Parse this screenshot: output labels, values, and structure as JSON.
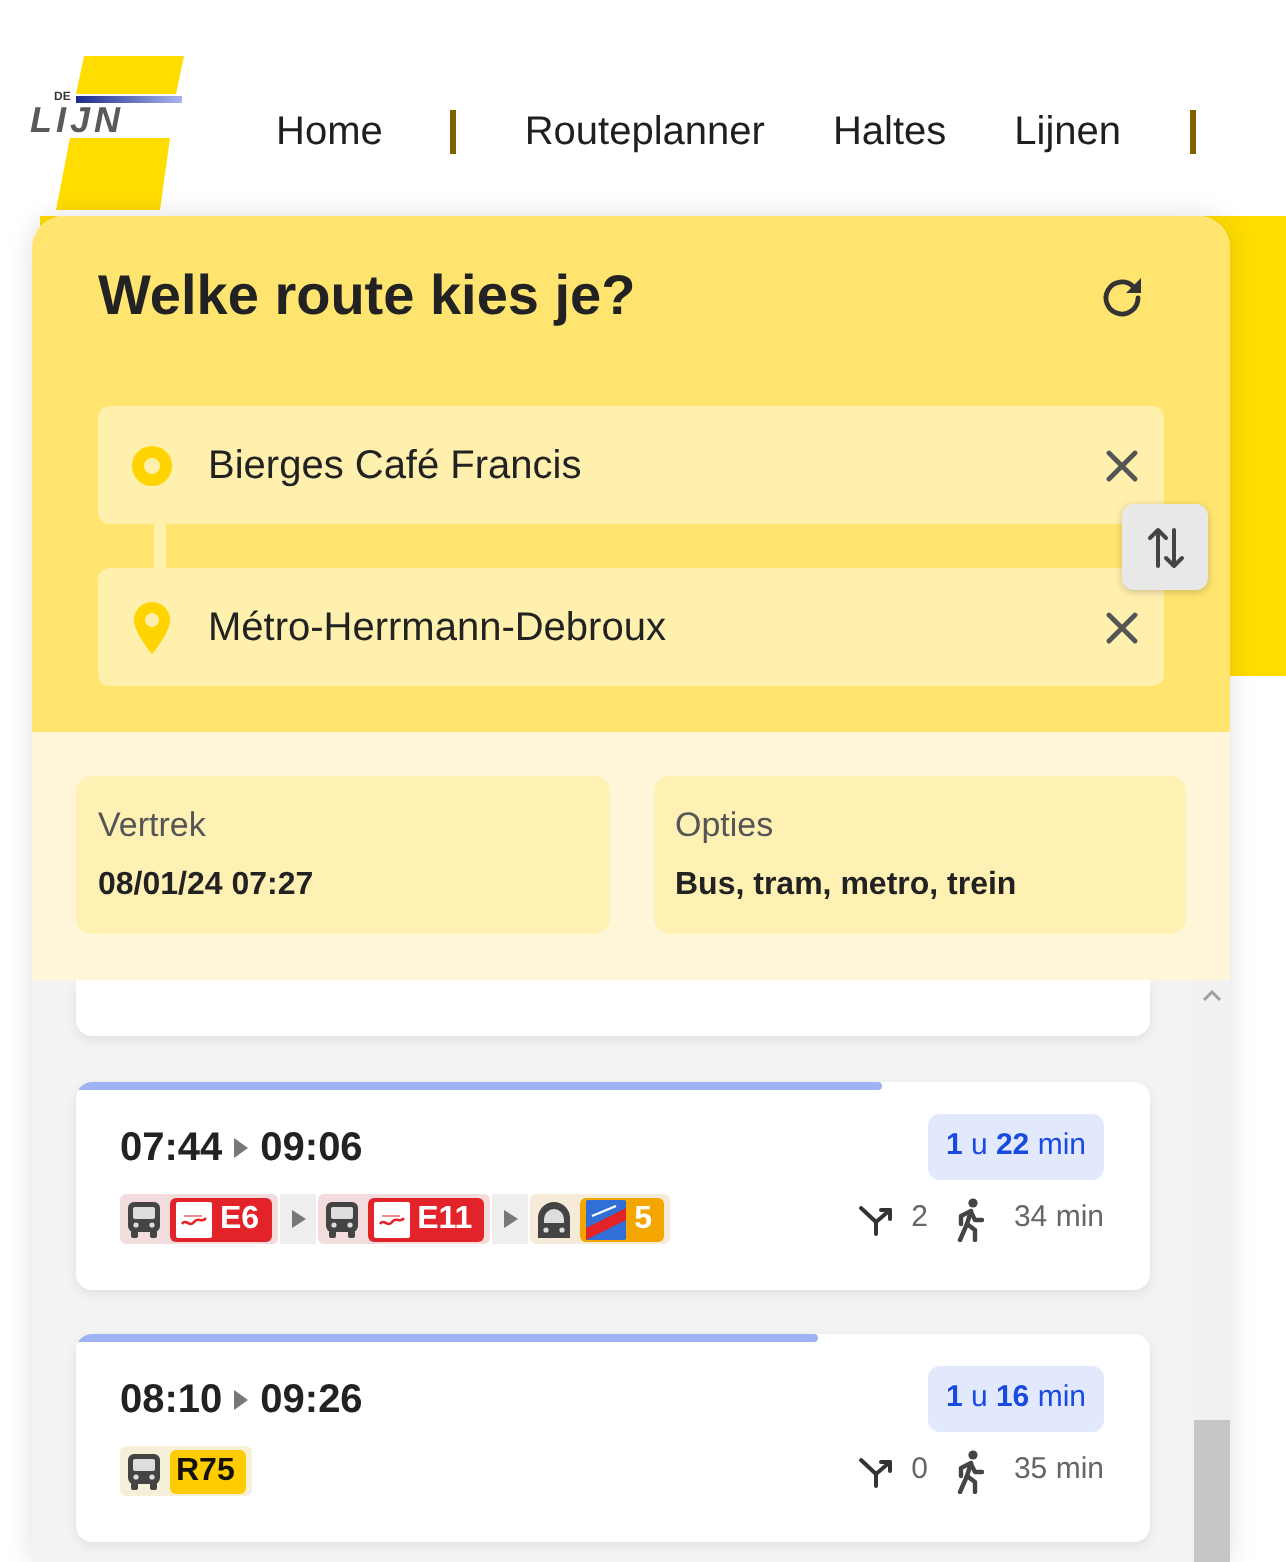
{
  "logo": {
    "small_text": "DE",
    "text": "LIJN"
  },
  "nav_groups": [
    {
      "items": [
        "Home"
      ]
    },
    {
      "items": [
        "Routeplanner",
        "Haltes",
        "Lijnen"
      ]
    }
  ],
  "planner": {
    "title": "Welke route kies je?",
    "from": {
      "value": "Bierges Café Francis"
    },
    "to": {
      "value": "Métro-Herrmann-Debroux"
    }
  },
  "options": [
    {
      "label": "Vertrek",
      "value": "08/01/24 07:27"
    },
    {
      "label": "Opties",
      "value": "Bus, tram, metro, trein"
    }
  ],
  "results": [
    {
      "kind": "clipped"
    },
    {
      "kind": "trip",
      "level": 0.75,
      "departure": "07:44",
      "arrival": "09:06",
      "duration": "**1** u **22** min",
      "legs": [
        {
          "kind": "bus",
          "badge": {
            "kind": "tec",
            "line": "E6",
            "color": "#e2232a"
          }
        },
        {
          "kind": "bus",
          "badge": {
            "kind": "tec",
            "line": "E11",
            "color": "#e2232a"
          }
        },
        {
          "kind": "metro",
          "badge": {
            "kind": "stib",
            "line": "5",
            "color": "#f5a500"
          }
        }
      ],
      "transfers": "2",
      "walking": "34 min"
    },
    {
      "kind": "trip",
      "level": 0.69,
      "departure": "08:10",
      "arrival": "09:26",
      "duration": "**1** u **16** min",
      "legs": [
        {
          "kind": "bus",
          "badge": {
            "kind": "plain",
            "line": "R75",
            "color": "#ffcc00"
          }
        }
      ],
      "transfers": "0",
      "walking": "35 min"
    }
  ]
}
